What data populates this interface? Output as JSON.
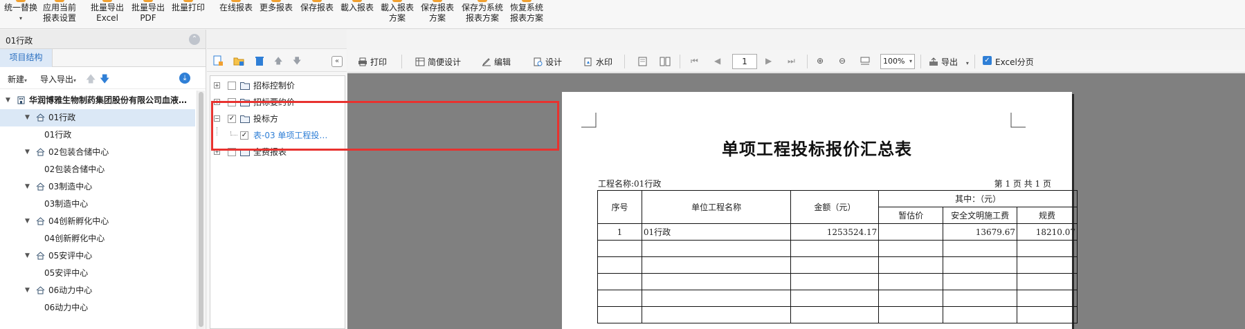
{
  "ribbon": {
    "buttons": [
      {
        "label1": "统一替换",
        "label2": "▾"
      },
      {
        "label1": "应用当前",
        "label2": "报表设置"
      },
      {
        "label1": "批量导出",
        "label2": "Excel"
      },
      {
        "label1": "批量导出",
        "label2": "PDF"
      },
      {
        "label1": "批量打印",
        "label2": ""
      },
      {
        "label1": "在线报表",
        "label2": ""
      },
      {
        "label1": "更多报表",
        "label2": ""
      },
      {
        "label1": "保存报表",
        "label2": ""
      },
      {
        "label1": "載入报表",
        "label2": ""
      },
      {
        "label1": "載入报表",
        "label2": "方案"
      },
      {
        "label1": "保存报表",
        "label2": "方案"
      },
      {
        "label1": "保存为系统",
        "label2": "报表方案"
      },
      {
        "label1": "恢复系统",
        "label2": "报表方案"
      }
    ]
  },
  "left": {
    "header_title": "01行政",
    "collapse_icon": "double-chevron-up-icon",
    "tab": "项目结构",
    "tools": {
      "new": "新建",
      "import_export": "导入导出"
    },
    "tree": [
      {
        "label": "华润博雅生物制药集团股份有限公司血液…",
        "level": 0,
        "bold": true,
        "expanded": true,
        "icon": "building-icon"
      },
      {
        "label": "01行政",
        "level": 1,
        "expanded": true,
        "selected": true,
        "icon": "home-icon"
      },
      {
        "label": "01行政",
        "level": 2
      },
      {
        "label": "02包装合储中心",
        "level": 1,
        "expanded": true,
        "icon": "home-icon"
      },
      {
        "label": "02包装合储中心",
        "level": 2
      },
      {
        "label": "03制造中心",
        "level": 1,
        "expanded": true,
        "icon": "home-icon"
      },
      {
        "label": "03制造中心",
        "level": 2
      },
      {
        "label": "04创新孵化中心",
        "level": 1,
        "expanded": true,
        "icon": "home-icon"
      },
      {
        "label": "04创新孵化中心",
        "level": 2
      },
      {
        "label": "05安评中心",
        "level": 1,
        "expanded": true,
        "icon": "home-icon"
      },
      {
        "label": "05安评中心",
        "level": 2
      },
      {
        "label": "06动力中心",
        "level": 1,
        "expanded": true,
        "icon": "home-icon"
      },
      {
        "label": "06动力中心",
        "level": 2
      }
    ]
  },
  "middle": {
    "tree": [
      {
        "label": "招标控制价",
        "toggle": "+",
        "checked": false
      },
      {
        "label": "招标要约价",
        "toggle": "+",
        "checked": false
      },
      {
        "label": "投标方",
        "toggle": "−",
        "checked": true
      },
      {
        "label": "表-03 单项工程投…",
        "toggle": "",
        "checked": true,
        "child": true
      },
      {
        "label": "全费报表",
        "toggle": "+",
        "checked": false
      }
    ]
  },
  "preview_toolbar": {
    "print": "打印",
    "simple_design": "简便设计",
    "edit": "编辑",
    "design": "设计",
    "watermark": "水印",
    "page": "1",
    "zoom": "100%",
    "export": "导出",
    "excel_paging": "Excel分页"
  },
  "report": {
    "title": "单项工程投标报价汇总表",
    "project_line": "工程名称:01行政",
    "page_line": "第 1 页  共 1 页",
    "headers": {
      "seq": "序号",
      "unit_name": "单位工程名称",
      "amount": "金额（元）",
      "among": "其中：（元）",
      "provisional": "暂估价",
      "safety": "安全文明施工费",
      "fees": "规费"
    },
    "rows": [
      {
        "seq": "1",
        "name": "01行政",
        "amount": "1253524.17",
        "provisional": "",
        "safety": "13679.67",
        "fees": "18210.07"
      }
    ]
  }
}
